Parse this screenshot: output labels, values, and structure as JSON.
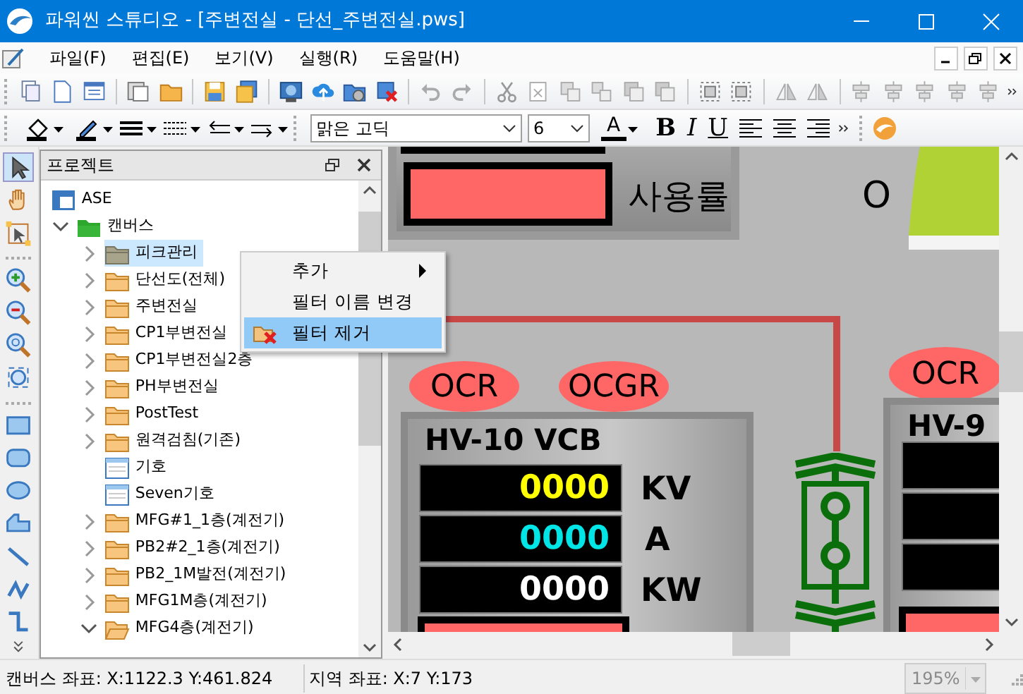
{
  "window": {
    "title": "파워씬 스튜디오 - [주변전실 - 단선_주변전실.pws]"
  },
  "menu": [
    "파일(F)",
    "편집(E)",
    "보기(V)",
    "실행(R)",
    "도움말(H)"
  ],
  "format_bar": {
    "font": "맑은 고딕",
    "size": "6",
    "font_color": "A",
    "bold": "B",
    "italic": "I",
    "underline": "U"
  },
  "project_panel": {
    "title": "프로젝트",
    "tree": [
      {
        "label": "ASE",
        "kind": "project",
        "selected": false,
        "children": [
          {
            "label": "캔버스",
            "kind": "group",
            "expanded": true,
            "selected": false,
            "children": [
              {
                "label": "피크관리",
                "kind": "folder",
                "expanded": false,
                "selected": true
              },
              {
                "label": "단선도(전체)",
                "kind": "folder",
                "expanded": false,
                "selected": false
              },
              {
                "label": "주변전실",
                "kind": "folder",
                "expanded": false,
                "selected": false
              },
              {
                "label": "CP1부변전실",
                "kind": "folder",
                "expanded": false,
                "selected": false
              },
              {
                "label": "CP1부변전실2층",
                "kind": "folder",
                "expanded": false,
                "selected": false
              },
              {
                "label": "PH부변전실",
                "kind": "folder",
                "expanded": false,
                "selected": false
              },
              {
                "label": "PostTest",
                "kind": "folder",
                "expanded": false,
                "selected": false
              },
              {
                "label": "원격검침(기존)",
                "kind": "folder",
                "expanded": false,
                "selected": false
              },
              {
                "label": "기호",
                "kind": "canvas",
                "selected": false
              },
              {
                "label": "Seven기호",
                "kind": "canvas",
                "selected": false
              },
              {
                "label": "MFG#1_1층(계전기)",
                "kind": "folder",
                "expanded": false,
                "selected": false
              },
              {
                "label": "PB2#2_1층(계전기)",
                "kind": "folder",
                "expanded": false,
                "selected": false
              },
              {
                "label": "PB2_1M발전(계전기)",
                "kind": "folder",
                "expanded": false,
                "selected": false
              },
              {
                "label": "MFG1M층(계전기)",
                "kind": "folder",
                "expanded": false,
                "selected": false
              },
              {
                "label": "MFG4층(계전기)",
                "kind": "folder",
                "expanded": true,
                "selected": false
              }
            ]
          }
        ]
      }
    ]
  },
  "context_menu": [
    {
      "label": "추가",
      "kind": "submenu",
      "selected": false
    },
    {
      "label": "필터 이름 변경",
      "kind": "plain",
      "selected": false
    },
    {
      "label": "필터 제거",
      "kind": "delete",
      "selected": true
    }
  ],
  "canvas": {
    "usage_label": "사용률",
    "mark": "O",
    "relays": [
      {
        "label": "OCR"
      },
      {
        "label": "OCGR"
      },
      {
        "label": "OCR"
      }
    ],
    "vcb_panel": {
      "title": "HV-10 VCB",
      "readings": [
        {
          "value": "0000",
          "unit": "KV",
          "color": "#ffff00"
        },
        {
          "value": "0000",
          "unit": "A",
          "color": "#00e5e5"
        },
        {
          "value": "0000",
          "unit": "KW",
          "color": "#ffffff"
        }
      ]
    },
    "side_panel": {
      "title": "HV-9"
    }
  },
  "status_bar": {
    "canvas_coords": "캔버스 좌표: X:1122.3 Y:461.824",
    "local_coords": "지역 좌표: X:7 Y:173",
    "zoom": {
      "value": "195%",
      "disabled": true
    }
  }
}
